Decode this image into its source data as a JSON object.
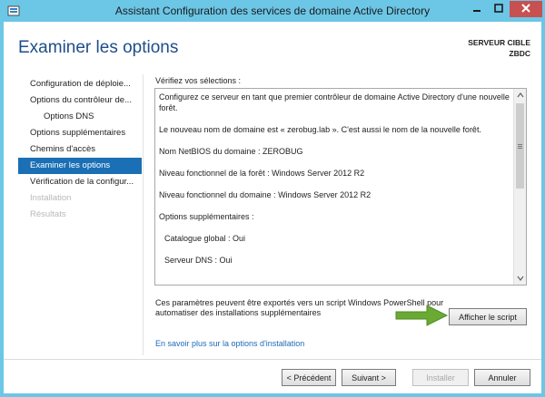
{
  "window": {
    "title": "Assistant Configuration des services de domaine Active Directory"
  },
  "header": {
    "page_title": "Examiner les options",
    "target_label": "SERVEUR CIBLE",
    "target_name": "ZBDC"
  },
  "nav": {
    "items": [
      {
        "label": "Configuration de déploie...",
        "state": "normal"
      },
      {
        "label": "Options du contrôleur de...",
        "state": "normal"
      },
      {
        "label": "Options DNS",
        "state": "normal"
      },
      {
        "label": "Options supplémentaires",
        "state": "normal"
      },
      {
        "label": "Chemins d'accès",
        "state": "normal"
      },
      {
        "label": "Examiner les options",
        "state": "active"
      },
      {
        "label": "Vérification de la configur...",
        "state": "normal"
      },
      {
        "label": "Installation",
        "state": "disabled"
      },
      {
        "label": "Résultats",
        "state": "disabled"
      }
    ]
  },
  "main": {
    "verify_label": "Vérifiez vos sélections :",
    "review_lines": [
      "Configurez ce serveur en tant que premier contrôleur de domaine Active Directory d'une nouvelle forêt.",
      "Le nouveau nom de domaine est « zerobug.lab ». C'est aussi le nom de la nouvelle forêt.",
      "Nom NetBIOS du domaine : ZEROBUG",
      "Niveau fonctionnel de la forêt : Windows Server 2012 R2",
      "Niveau fonctionnel du domaine : Windows Server 2012 R2",
      "Options supplémentaires :",
      "Catalogue global : Oui",
      "Serveur DNS : Oui"
    ],
    "export_text": "Ces paramètres peuvent être exportés vers un script Windows PowerShell pour automatiser des installations supplémentaires",
    "script_button": "Afficher le script",
    "more_link": "En savoir plus sur la options d'installation"
  },
  "footer": {
    "prev": "< Précédent",
    "next": "Suivant >",
    "install": "Installer",
    "cancel": "Annuler"
  },
  "colors": {
    "titlebar": "#6cc6e6",
    "accent": "#1a6fb5",
    "title_text": "#1e4e8a",
    "link": "#1e6bb8",
    "arrow": "#6aaa34",
    "close_button": "#c75050"
  },
  "icons": {
    "app": "server-manager-icon",
    "minimize": "minimize-icon",
    "maximize": "maximize-icon",
    "close": "close-icon",
    "scroll_up": "chevron-up-icon",
    "scroll_down": "chevron-down-icon",
    "pointer_arrow": "arrow-right-icon"
  }
}
